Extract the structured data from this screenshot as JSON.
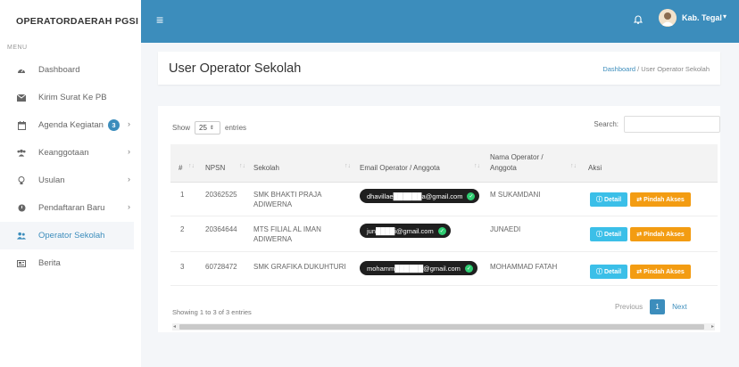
{
  "brand": "OPERATORDAERAH PGSI",
  "menu_caption": "MENU",
  "sidebar": {
    "items": [
      {
        "label": "Dashboard",
        "icon": "dashboard-icon"
      },
      {
        "label": "Kirim Surat Ke PB",
        "icon": "mail-icon"
      },
      {
        "label": "Agenda Kegiatan",
        "icon": "calendar-icon",
        "badge": "3"
      },
      {
        "label": "Keanggotaan",
        "icon": "users-icon"
      },
      {
        "label": "Usulan",
        "icon": "lightbulb-icon"
      },
      {
        "label": "Pendaftaran Baru",
        "icon": "circle-icon"
      },
      {
        "label": "Operator Sekolah",
        "icon": "user-group-icon",
        "active": true
      },
      {
        "label": "Berita",
        "icon": "newspaper-icon"
      }
    ]
  },
  "topbar": {
    "menu_icon": "≡",
    "user_name": "Kab. Tegal",
    "caret": "▾",
    "accent": "#3c8dbc"
  },
  "page": {
    "title": "User Operator Sekolah",
    "breadcrumb_home": "Dashboard",
    "breadcrumb_sep": "/",
    "breadcrumb_current": "User Operator Sekolah"
  },
  "table": {
    "show_label": "Show",
    "entries_value": "25",
    "entries_label": "entries",
    "search_label": "Search:",
    "headers": {
      "no": "#",
      "npsn": "NPSN",
      "sekolah": "Sekolah",
      "email": "Email Operator / Anggota",
      "nama_1": "Nama Operator /",
      "nama_2": "Anggota",
      "aksi": "Aksi"
    },
    "rows": [
      {
        "no": "1",
        "npsn": "20362525",
        "sekolah_1": "SMK BHAKTI PRAJA",
        "sekolah_2": "ADIWERNA",
        "email": "dhavillae██████a@gmail.com",
        "nama": "M SUKAMDANI"
      },
      {
        "no": "2",
        "npsn": "20364644",
        "sekolah_1": "MTS FILIAL AL IMAN",
        "sekolah_2": "ADIWERNA",
        "email": "jun████i@gmail.com",
        "nama": "JUNAEDI"
      },
      {
        "no": "3",
        "npsn": "60728472",
        "sekolah_1": "SMK GRAFIKA DUKUHTURI",
        "sekolah_2": "",
        "email": "mohamm██████@gmail.com",
        "nama": "MOHAMMAD FATAH"
      }
    ],
    "detail_label": "Detail",
    "pindah_label": "Pindah Akses",
    "info": "Showing 1 to 3 of 3 entries",
    "prev_label": "Previous",
    "current_page": "1",
    "next_label": "Next"
  }
}
